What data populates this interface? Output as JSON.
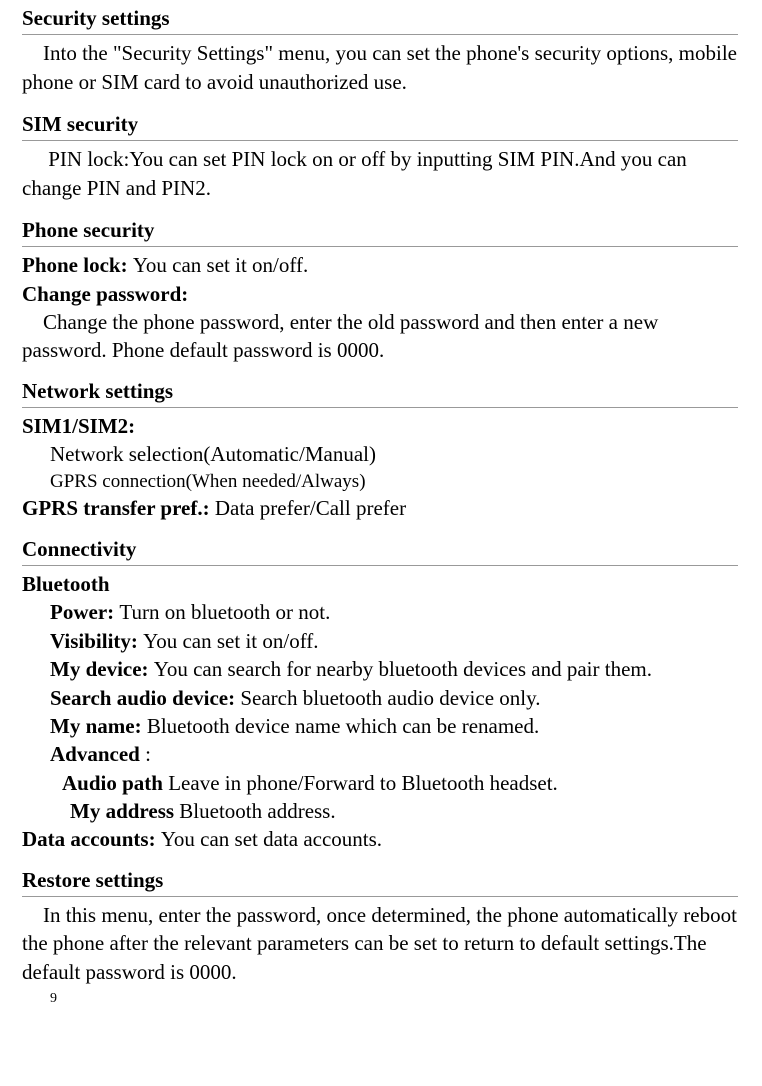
{
  "security_settings": {
    "heading": "Security settings",
    "intro": "    Into the \"Security Settings\" menu, you can set the phone's security options, mobile phone or SIM card to avoid unauthorized use."
  },
  "sim_security": {
    "heading": "SIM security",
    "pin_lock": "     PIN lock:You can set PIN lock on or off by inputting SIM PIN.And you can change PIN and PIN2."
  },
  "phone_security": {
    "heading": "Phone security",
    "phone_lock_label": "Phone lock: ",
    "phone_lock_desc": "You can set it on/off.",
    "change_password_label": "Change password:",
    "change_password_desc": "    Change the phone password, enter the old password and then enter a new password. Phone default password is 0000."
  },
  "network_settings": {
    "heading": "Network settings",
    "sim_label": "SIM1/SIM2:",
    "network_selection": "Network selection(Automatic/Manual)",
    "gprs_connection": "GPRS connection(When needed/Always)",
    "gprs_transfer_label": "GPRS transfer pref.:  ",
    "gprs_transfer_value": "Data prefer/Call prefer"
  },
  "connectivity": {
    "heading": "Connectivity",
    "bluetooth_label": "Bluetooth",
    "power_label": "Power:  ",
    "power_desc": "Turn on bluetooth or not.",
    "visibility_label": "Visibility: ",
    "visibility_desc": "You can set it on/off.",
    "my_device_label": "My device: ",
    "my_device_desc": "You can search for nearby bluetooth devices and pair them.",
    "search_audio_label": "Search audio device:  ",
    "search_audio_desc": "Search bluetooth audio device only.",
    "my_name_label": "My name: ",
    "my_name_desc": "Bluetooth device name which can be renamed.",
    "advanced_label": "Advanced ",
    "advanced_colon": ":",
    "audio_path_label": "Audio path  ",
    "audio_path_desc": "Leave in phone/Forward to Bluetooth headset.",
    "my_address_label": "My address  ",
    "my_address_desc": "Bluetooth address.",
    "data_accounts_label": "Data accounts:  ",
    "data_accounts_desc": "You can set data accounts."
  },
  "restore_settings": {
    "heading": "Restore settings",
    "desc": "    In this menu, enter the password, once determined, the phone automatically reboot the phone after the relevant parameters can be set to return to default settings.The default password is 0000."
  },
  "page_number": "9"
}
